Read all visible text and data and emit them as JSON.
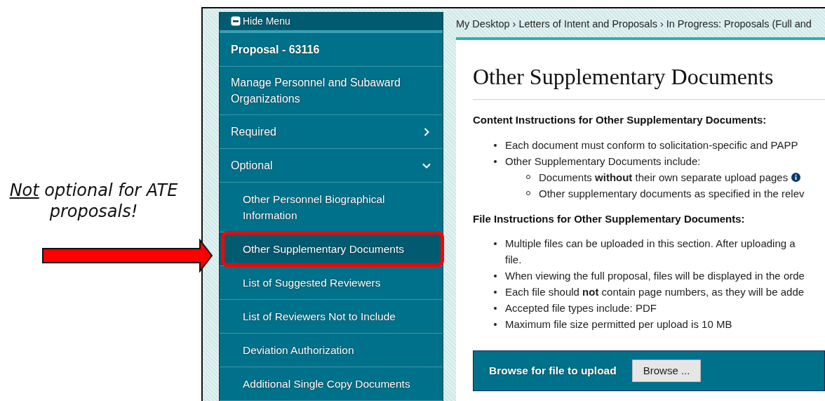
{
  "annotation": {
    "emphasis": "Not",
    "text": "optional for ATE proposals!"
  },
  "sidebar": {
    "toggle": "Hide Menu",
    "title": "Proposal - 63116",
    "items": [
      {
        "kind": "link",
        "label": "Manage Personnel and Subaward Organizations"
      },
      {
        "kind": "group",
        "label": "Required",
        "expanded": false
      },
      {
        "kind": "group",
        "label": "Optional",
        "expanded": true,
        "children": [
          {
            "label": "Other Personnel Biographical Information",
            "selected": false
          },
          {
            "label": "Other Supplementary Documents",
            "selected": true
          },
          {
            "label": "List of Suggested Reviewers",
            "selected": false
          },
          {
            "label": "List of Reviewers Not to Include",
            "selected": false
          },
          {
            "label": "Deviation Authorization",
            "selected": false
          },
          {
            "label": "Additional Single Copy Documents",
            "selected": false
          }
        ]
      }
    ]
  },
  "breadcrumb": [
    {
      "label": "My Desktop",
      "separator": "›"
    },
    {
      "label": "Letters of Intent and Proposals",
      "separator": "›"
    },
    {
      "label": "In Progress: Proposals (Full and"
    }
  ],
  "page": {
    "title": "Other Supplementary Documents",
    "sections": [
      {
        "heading": "Content Instructions for Other Supplementary Documents:",
        "bullets": [
          {
            "text": "Each document must conform to solicitation-specific and PAPP"
          },
          {
            "text": "Other Supplementary Documents include:",
            "children": [
              {
                "text": "Documents **without** their own separate upload pages",
                "info": true
              },
              {
                "text": "Other supplementary documents as specified in the relev",
                "info": false
              }
            ]
          }
        ]
      },
      {
        "heading": "File Instructions for Other Supplementary Documents:",
        "bullets": [
          {
            "text": "Multiple files can be uploaded in this section. After uploading a",
            "continuation": "file."
          },
          {
            "text": "When viewing the full proposal, files will be displayed in the orde"
          },
          {
            "text": "Each file should **not** contain page numbers, as they will be adde"
          },
          {
            "text": "Accepted file types include: PDF"
          },
          {
            "text": "Maximum file size permitted per upload is 10 MB"
          }
        ]
      }
    ]
  },
  "upload": {
    "label": "Browse for file to upload",
    "button": "Browse ..."
  }
}
